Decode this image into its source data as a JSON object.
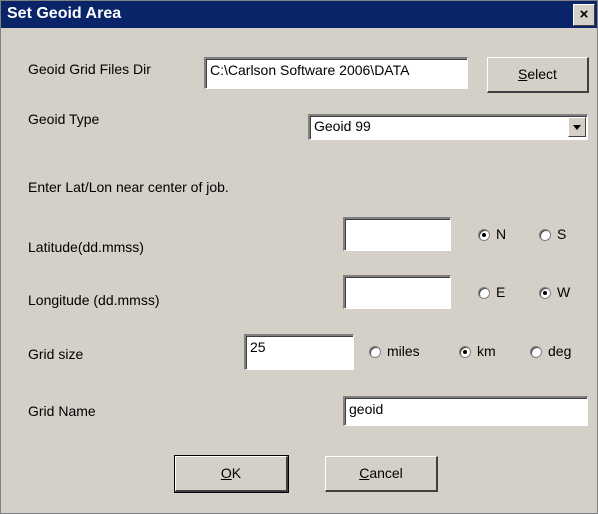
{
  "window": {
    "title": "Set Geoid Area",
    "close_glyph": "×"
  },
  "geoid_dir": {
    "label": "Geoid Grid Files Dir",
    "value": "C:\\Carlson Software 2006\\DATA",
    "select_label_u": "S",
    "select_label_rest": "elect"
  },
  "geoid_type": {
    "label": "Geoid Type",
    "value": "Geoid 99"
  },
  "instructions": "Enter Lat/Lon near center of job.",
  "latitude": {
    "label": "Latitude(dd.mmss)",
    "value": "",
    "opt1": "N",
    "opt2": "S",
    "selected": "N"
  },
  "longitude": {
    "label": "Longitude (dd.mmss)",
    "value": "",
    "opt1": "E",
    "opt2": "W",
    "selected": "W"
  },
  "grid_size": {
    "label": "Grid size",
    "value": "25",
    "opt1": "miles",
    "opt2": "km",
    "opt3": "deg",
    "selected": "km"
  },
  "grid_name": {
    "label": "Grid Name",
    "value": "geoid"
  },
  "buttons": {
    "ok_u": "O",
    "ok_rest": "K",
    "cancel_u": "C",
    "cancel_rest": "ancel"
  }
}
